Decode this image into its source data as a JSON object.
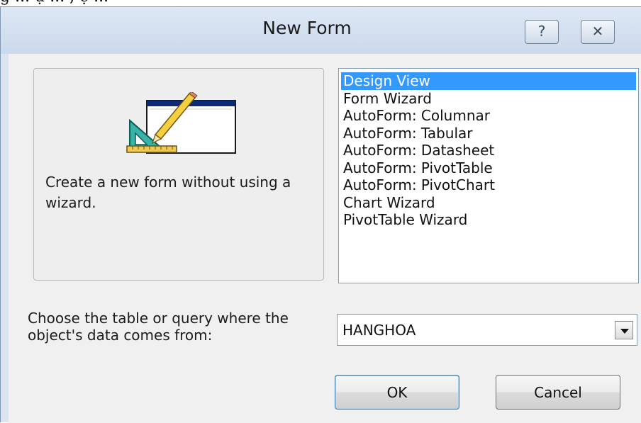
{
  "header_caption": "g ... ự ... , ệ ...",
  "dialog": {
    "title": "New Form",
    "help_glyph": "?",
    "close_glyph": "✕"
  },
  "preview": {
    "description": "Create a new form without using a wizard."
  },
  "view_list": {
    "items": [
      "Design View",
      "Form Wizard",
      "AutoForm:  Columnar",
      "AutoForm:  Tabular",
      "AutoForm:  Datasheet",
      "AutoForm:  PivotTable",
      "AutoForm:  PivotChart",
      "Chart Wizard",
      "PivotTable Wizard"
    ],
    "selected_index": 0
  },
  "source": {
    "label": "Choose the table or query where the object's data comes from:",
    "value": "HANGHOA"
  },
  "buttons": {
    "ok": "OK",
    "cancel": "Cancel"
  },
  "colors": {
    "selection": "#3399ff",
    "titlebar": "#d6e2f1",
    "dialog_bg": "#f0f0f0"
  }
}
